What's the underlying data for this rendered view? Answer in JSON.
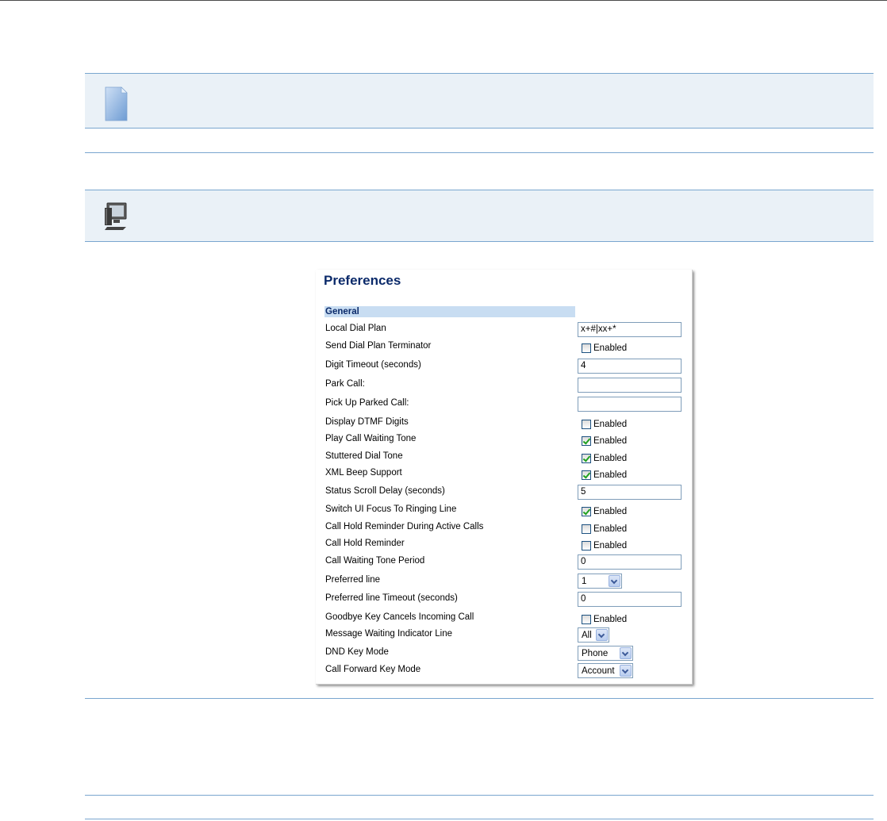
{
  "panel": {
    "title": "Preferences",
    "section": "General",
    "rows": [
      {
        "label": "Local Dial Plan",
        "type": "text",
        "value": "x+#|xx+*"
      },
      {
        "label": "Send Dial Plan Terminator",
        "type": "checkbox",
        "checked": false,
        "text": "Enabled"
      },
      {
        "label": "Digit Timeout (seconds)",
        "type": "text",
        "value": "4"
      },
      {
        "label": "Park Call:",
        "type": "text",
        "value": ""
      },
      {
        "label": "Pick Up Parked Call:",
        "type": "text",
        "value": ""
      },
      {
        "label": "Display DTMF Digits",
        "type": "checkbox",
        "checked": false,
        "text": "Enabled"
      },
      {
        "label": "Play Call Waiting Tone",
        "type": "checkbox",
        "checked": true,
        "text": "Enabled"
      },
      {
        "label": "Stuttered Dial Tone",
        "type": "checkbox",
        "checked": true,
        "text": "Enabled"
      },
      {
        "label": "XML Beep Support",
        "type": "checkbox",
        "checked": true,
        "text": "Enabled"
      },
      {
        "label": "Status Scroll Delay (seconds)",
        "type": "text",
        "value": "5"
      },
      {
        "label": "Switch UI Focus To Ringing Line",
        "type": "checkbox",
        "checked": true,
        "text": "Enabled"
      },
      {
        "label": "Call Hold Reminder During Active Calls",
        "type": "checkbox",
        "checked": false,
        "text": "Enabled"
      },
      {
        "label": "Call Hold Reminder",
        "type": "checkbox",
        "checked": false,
        "text": "Enabled"
      },
      {
        "label": "Call Waiting Tone Period",
        "type": "text",
        "value": "0"
      },
      {
        "label": "Preferred line",
        "type": "select",
        "value": "1"
      },
      {
        "label": "Preferred line Timeout (seconds)",
        "type": "text",
        "value": "0"
      },
      {
        "label": "Goodbye Key Cancels Incoming Call",
        "type": "checkbox",
        "checked": false,
        "text": "Enabled"
      },
      {
        "label": "Message Waiting Indicator Line",
        "type": "select",
        "value": "All"
      },
      {
        "label": "DND Key Mode",
        "type": "select",
        "value": "Phone"
      },
      {
        "label": "Call Forward Key Mode",
        "type": "select",
        "value": "Account"
      }
    ]
  },
  "icons": {
    "note": "note-icon",
    "computer": "computer-icon"
  }
}
